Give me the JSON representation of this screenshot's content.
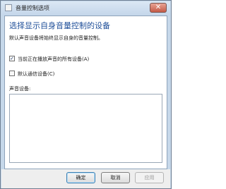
{
  "window": {
    "title": "音量控制选项"
  },
  "icons": {
    "app": "app-window-icon",
    "close": "close-icon"
  },
  "content": {
    "heading": "选择显示自身音量控制的设备",
    "description": "默认声音设备将始终显示自身的音量控制。",
    "checkboxes": [
      {
        "label": "当前正在播放声音的所有设备(A)",
        "checked": true
      },
      {
        "label": "默认通信设备(C)",
        "checked": false
      }
    ],
    "list_label": "声音设备:"
  },
  "buttons": {
    "ok": "确定",
    "cancel": "取消",
    "apply": "应用"
  },
  "colors": {
    "heading": "#1f4f99",
    "titlebar": "#c4d6ea",
    "footer": "#eeeeee"
  }
}
